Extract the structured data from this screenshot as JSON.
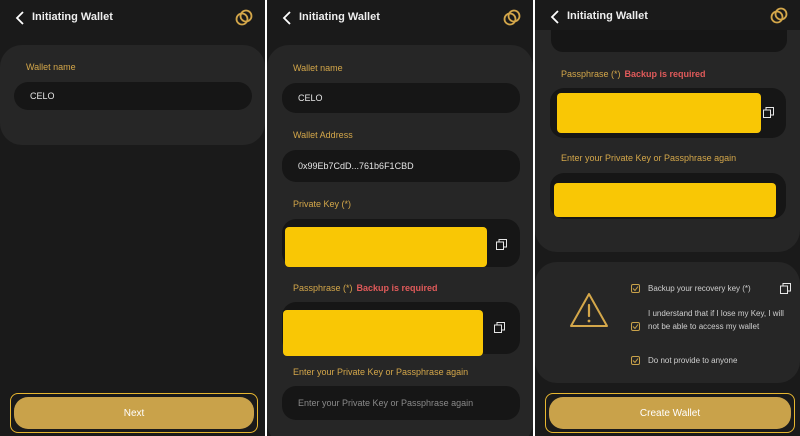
{
  "header": {
    "title": "Initiating Wallet"
  },
  "screen1": {
    "wallet_name_label": "Wallet name",
    "wallet_name_value": "CELO",
    "next_label": "Next"
  },
  "screen2": {
    "wallet_name_label": "Wallet name",
    "wallet_name_value": "CELO",
    "wallet_address_label": "Wallet Address",
    "wallet_address_value": "0x99Eb7CdD...761b6F1CBD",
    "private_key_label": "Private Key (*)",
    "passphrase_label": "Passphrase (*)",
    "backup_required": "Backup is required",
    "reenter_label": "Enter your Private Key or Passphrase again",
    "reenter_placeholder": "Enter your Private Key or Passphrase again"
  },
  "screen3": {
    "passphrase_label": "Passphrase (*)",
    "backup_required": "Backup is required",
    "reenter_label": "Enter your Private Key or Passphrase again",
    "ack_items": [
      "Backup your recovery key (*)",
      "I understand that if I lose my Key, I will not be able to access my wallet",
      "Do not provide to anyone"
    ],
    "create_label": "Create Wallet"
  },
  "icons": {
    "back": "chevron-left-icon",
    "chain": "link-rings-icon",
    "copy": "copy-icon",
    "warning": "warning-triangle-icon",
    "check": "checkbox-checked-icon"
  },
  "colors": {
    "background": "#1a1a1a",
    "card": "#262626",
    "field": "#161616",
    "accent": "#d4a74a",
    "button": "#c9a24a",
    "masked": "#f9c705",
    "required": "#e05a5a"
  }
}
